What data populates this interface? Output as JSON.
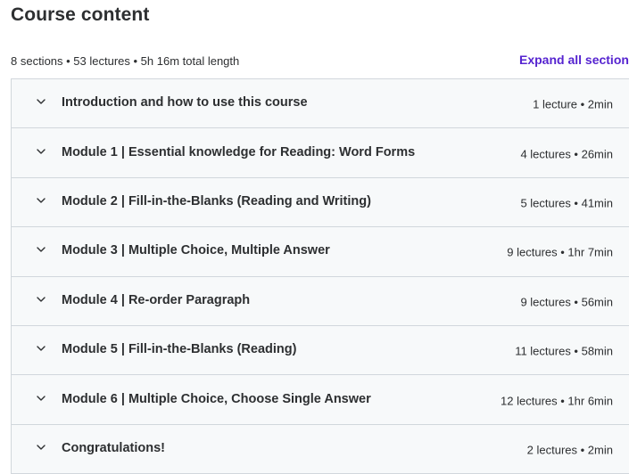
{
  "page": {
    "title": "Course content",
    "summary": "8 sections • 53 lectures • 5h 16m total length",
    "expand_all_label": "Expand all sections"
  },
  "sections": [
    {
      "title": "Introduction and how to use this course",
      "info": "1 lecture • 2min"
    },
    {
      "title": "Module 1 | Essential knowledge for Reading: Word Forms",
      "info": "4 lectures • 26min"
    },
    {
      "title": "Module 2 | Fill-in-the-Blanks (Reading and Writing)",
      "info": "5 lectures • 41min"
    },
    {
      "title": "Module 3 | Multiple Choice, Multiple Answer",
      "info": "9 lectures • 1hr 7min"
    },
    {
      "title": "Module 4 | Re-order Paragraph",
      "info": "9 lectures • 56min"
    },
    {
      "title": "Module 5 | Fill-in-the-Blanks (Reading)",
      "info": "11 lectures • 58min"
    },
    {
      "title": "Module 6 | Multiple Choice, Choose Single Answer",
      "info": "12 lectures • 1hr 6min"
    },
    {
      "title": "Congratulations!",
      "info": "2 lectures • 2min"
    }
  ],
  "icons": {
    "section_toggle": "chevron-down-icon"
  },
  "colors": {
    "accent": "#5624d0",
    "row_background": "#f7f9fa",
    "border": "#d1d7dc",
    "text": "#2d2f31"
  }
}
